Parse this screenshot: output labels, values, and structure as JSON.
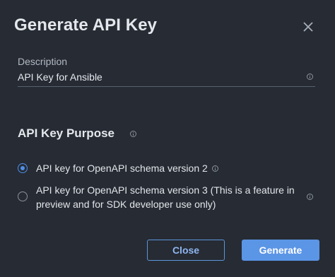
{
  "dialog": {
    "title": "Generate API Key",
    "close_icon": "close-x-icon"
  },
  "description": {
    "label": "Description",
    "value": "API Key for Ansible",
    "info_icon": "info-icon"
  },
  "purpose": {
    "title": "API Key Purpose",
    "info_icon": "info-icon",
    "options": [
      {
        "label": "API key for OpenAPI schema version 2",
        "checked": true
      },
      {
        "label": "API key for OpenAPI schema version 3 (This is a feature in preview and for SDK developer use only)",
        "checked": false
      }
    ]
  },
  "buttons": {
    "close_label": "Close",
    "generate_label": "Generate"
  },
  "colors": {
    "background": "#262b34",
    "accent": "#5b95e6",
    "text": "#e4e7eb"
  }
}
